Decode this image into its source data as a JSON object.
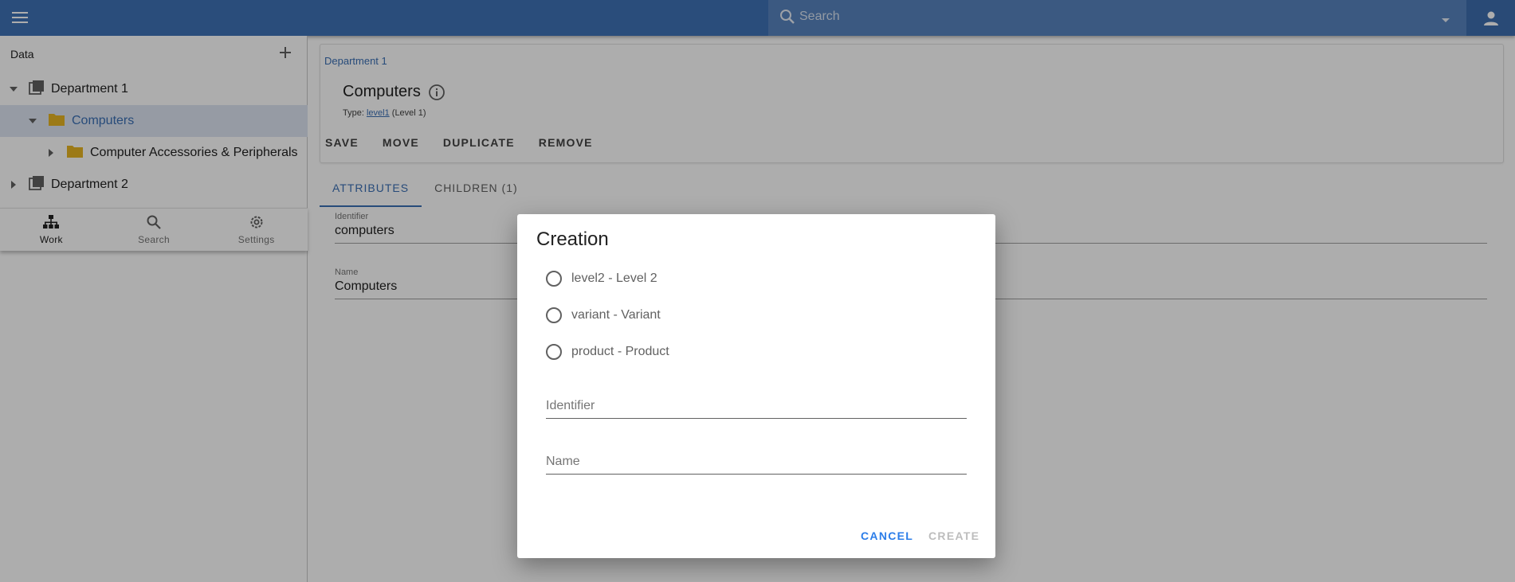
{
  "appbar": {
    "search_placeholder": "Search",
    "menu_icon": "hamburger-menu-icon",
    "account_icon": "person-icon"
  },
  "sidebar": {
    "header": "Data",
    "tree": [
      {
        "label": "Department 1",
        "icon": "catalog-icon",
        "expanded": true,
        "level": 0
      },
      {
        "label": "Computers",
        "icon": "folder-icon",
        "expanded": true,
        "level": 1,
        "selected": true
      },
      {
        "label": "Computer Accessories & Peripherals",
        "icon": "folder-icon",
        "expanded": false,
        "level": 2
      },
      {
        "label": "Department 2",
        "icon": "catalog-icon",
        "expanded": false,
        "level": 0
      }
    ],
    "bottom_nav": [
      {
        "label": "Work",
        "icon": "hierarchy-icon",
        "active": true
      },
      {
        "label": "Search",
        "icon": "search-icon",
        "active": false
      },
      {
        "label": "Settings",
        "icon": "gear-icon",
        "active": false
      }
    ]
  },
  "main": {
    "breadcrumb": "Department 1",
    "title": "Computers",
    "type_prefix": "Type:",
    "type_link": "level1",
    "type_suffix": "(Level 1)",
    "actions": [
      "SAVE",
      "MOVE",
      "DUPLICATE",
      "REMOVE"
    ],
    "tabs": [
      {
        "label": "ATTRIBUTES",
        "active": true
      },
      {
        "label": "CHILDREN (1)",
        "active": false
      }
    ],
    "fields": [
      {
        "label": "Identifier",
        "value": "computers"
      },
      {
        "label": "Name",
        "value": "Computers"
      }
    ]
  },
  "dialog": {
    "title": "Creation",
    "options": [
      "level2 - Level 2",
      "variant - Variant",
      "product - Product"
    ],
    "identifier_placeholder": "Identifier",
    "name_placeholder": "Name",
    "cancel_label": "CANCEL",
    "create_label": "CREATE"
  },
  "colors": {
    "appbar": "#3f72b5",
    "accent": "#3a6fb4",
    "folder": "#e6b422",
    "selected_row": "#dde5f2"
  }
}
